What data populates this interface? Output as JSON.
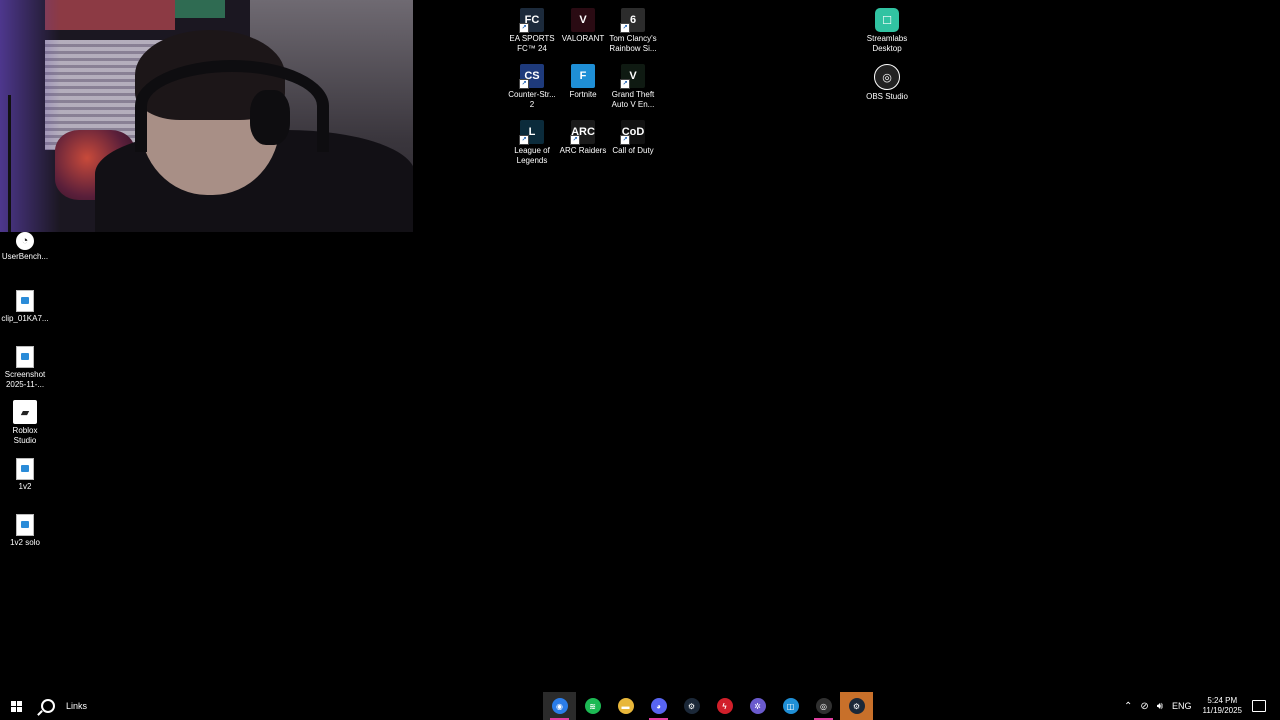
{
  "desktop": {
    "icons": [
      {
        "label": "EA SPORTS\nFC™ 24",
        "icon": "ea-sports-fc-24-icon",
        "color": "#1c2a3b",
        "glyph": "FC",
        "shortcut": true
      },
      {
        "label": "VALORANT",
        "icon": "valorant-icon",
        "color": "#2a0b13",
        "glyph": "V",
        "shortcut": false
      },
      {
        "label": "Tom Clancy's\nRainbow Si...",
        "icon": "rainbow-six-icon",
        "color": "#2c2c2c",
        "glyph": "6",
        "shortcut": true
      },
      {
        "label": "Streamlabs\nDesktop",
        "icon": "streamlabs-icon",
        "color": "#31c3a2",
        "glyph": "☐",
        "shortcut": false
      },
      {
        "label": "Counter-Str...\n2",
        "icon": "counter-strike-2-icon",
        "color": "#1e3a7b",
        "glyph": "CS",
        "shortcut": true
      },
      {
        "label": "Fortnite",
        "icon": "fortnite-icon",
        "color": "#1f8fd6",
        "glyph": "F",
        "shortcut": false
      },
      {
        "label": "Grand Theft\nAuto V En...",
        "icon": "gta-v-icon",
        "color": "#0f1a12",
        "glyph": "V",
        "shortcut": true
      },
      {
        "label": "OBS Studio",
        "icon": "obs-studio-icon",
        "color": "#222222",
        "glyph": "◎",
        "shortcut": false
      },
      {
        "label": "League of\nLegends",
        "icon": "league-of-legends-icon",
        "color": "#0b2b3b",
        "glyph": "L",
        "shortcut": true
      },
      {
        "label": "ARC Raiders",
        "icon": "arc-raiders-icon",
        "color": "#1a1a1a",
        "glyph": "ARC",
        "shortcut": true
      },
      {
        "label": "Call of Duty",
        "icon": "call-of-duty-icon",
        "color": "#111111",
        "glyph": "CoD",
        "shortcut": true
      },
      {
        "label": "UserBench...",
        "icon": "userbenchmark-icon",
        "color": "#ffffff",
        "glyph": "◔",
        "shortcut": false
      },
      {
        "label": "clip_01KA7...",
        "icon": "image-file-icon",
        "color": "#ffffff",
        "glyph": "",
        "shortcut": false
      },
      {
        "label": "Screenshot\n2025-11-...",
        "icon": "image-file-icon",
        "color": "#ffffff",
        "glyph": "",
        "shortcut": false
      },
      {
        "label": "Roblox\nStudio",
        "icon": "roblox-studio-icon",
        "color": "#ffffff",
        "glyph": "▰",
        "shortcut": false
      },
      {
        "label": "1v2",
        "icon": "image-file-icon",
        "color": "#ffffff",
        "glyph": "",
        "shortcut": false
      },
      {
        "label": "1v2 solo",
        "icon": "image-file-icon",
        "color": "#ffffff",
        "glyph": "",
        "shortcut": false
      }
    ]
  },
  "taskbar": {
    "search_label": "Links",
    "apps": [
      {
        "name": "chrome-icon",
        "color": "#2b7de9",
        "glyph": "◉"
      },
      {
        "name": "spotify-icon",
        "color": "#1db954",
        "glyph": "≋"
      },
      {
        "name": "file-explorer-icon",
        "color": "#e8b73a",
        "glyph": "▬"
      },
      {
        "name": "discord-icon",
        "color": "#5865f2",
        "glyph": "◕"
      },
      {
        "name": "steam-icon",
        "color": "#1b2838",
        "glyph": "⚙"
      },
      {
        "name": "red-app-icon",
        "color": "#d11f2a",
        "glyph": "ϟ"
      },
      {
        "name": "pinwheel-app-icon",
        "color": "#6a5acd",
        "glyph": "✲"
      },
      {
        "name": "blue-square-app-icon",
        "color": "#1f8fd6",
        "glyph": "◫"
      },
      {
        "name": "obs-studio-taskbar-icon",
        "color": "#303030",
        "glyph": "◎"
      },
      {
        "name": "steam-active-icon",
        "color": "#1b2838",
        "glyph": "⚙"
      }
    ],
    "tray": {
      "language": "ENG",
      "time": "5:24 PM",
      "date": "11/19/2025"
    }
  }
}
